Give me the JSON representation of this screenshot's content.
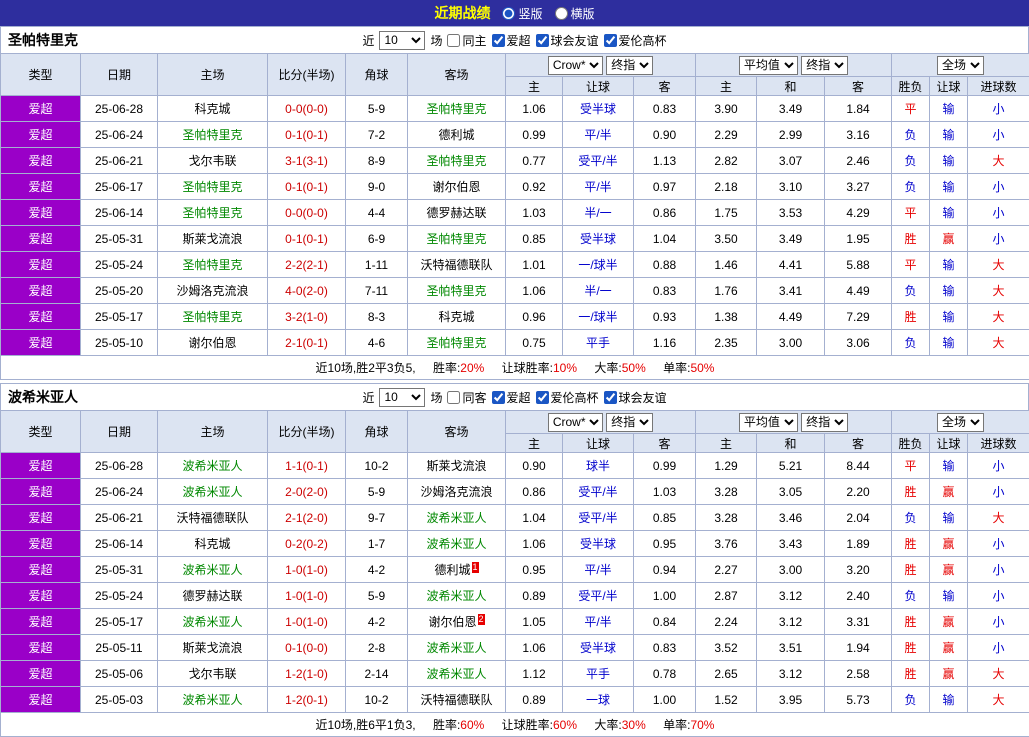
{
  "topbar": {
    "title": "近期战绩",
    "view_options": [
      {
        "label": "竖版",
        "selected": true
      },
      {
        "label": "横版",
        "selected": false
      }
    ]
  },
  "palette": {
    "topbar_bg": "#2e2e9e",
    "title_color": "#ffff00",
    "type_cell_bg": "#9a00c8",
    "header_bg": "#dce4f2",
    "border": "#a4b0d0",
    "win_color": "#e60000",
    "loss_color": "#0000cc",
    "self_team_color": "#008800",
    "score_color": "#cc0000"
  },
  "columns": {
    "type": "类型",
    "date": "日期",
    "home": "主场",
    "score": "比分(半场)",
    "corner": "角球",
    "away": "客场",
    "odds_source": "Crow*",
    "odds_kind": "终指",
    "avg_source": "平均值",
    "avg_kind": "终指",
    "result_scope": "全场",
    "sub_odds_home": "主",
    "sub_odds_handicap": "让球",
    "sub_odds_away": "客",
    "sub_avg_home": "主",
    "sub_avg_draw": "和",
    "sub_avg_away": "客",
    "sub_result": "胜负",
    "sub_handicap_result": "让球",
    "sub_goals": "进球数"
  },
  "sections": [
    {
      "team": "圣帕特里克",
      "filter": {
        "near_label": "近",
        "match_count": "10",
        "games_label": "场",
        "same_venue_label": "同主",
        "same_venue_checked": false,
        "league_options": [
          "爱超",
          "球会友谊",
          "爱伦高杯"
        ]
      },
      "rows": [
        {
          "type": "爱超",
          "date": "25-06-28",
          "home": "科克城",
          "home_color": "black",
          "score": "0-0(0-0)",
          "corner": "5-9",
          "away": "圣帕特里克",
          "away_color": "green",
          "odds_home": "1.06",
          "handicap": "受半球",
          "odds_away": "0.83",
          "avg_home": "3.90",
          "avg_draw": "3.49",
          "avg_away": "1.84",
          "result": "平",
          "result_color": "red",
          "handicap_result": "输",
          "handicap_result_color": "blue",
          "goals": "小",
          "goals_color": "blue"
        },
        {
          "type": "爱超",
          "date": "25-06-24",
          "home": "圣帕特里克",
          "home_color": "green",
          "score": "0-1(0-1)",
          "corner": "7-2",
          "away": "德利城",
          "away_color": "black",
          "odds_home": "0.99",
          "handicap": "平/半",
          "odds_away": "0.90",
          "avg_home": "2.29",
          "avg_draw": "2.99",
          "avg_away": "3.16",
          "result": "负",
          "result_color": "blue",
          "handicap_result": "输",
          "handicap_result_color": "blue",
          "goals": "小",
          "goals_color": "blue"
        },
        {
          "type": "爱超",
          "date": "25-06-21",
          "home": "戈尔韦联",
          "home_color": "black",
          "score": "3-1(3-1)",
          "corner": "8-9",
          "away": "圣帕特里克",
          "away_color": "green",
          "odds_home": "0.77",
          "handicap": "受平/半",
          "odds_away": "1.13",
          "avg_home": "2.82",
          "avg_draw": "3.07",
          "avg_away": "2.46",
          "result": "负",
          "result_color": "blue",
          "handicap_result": "输",
          "handicap_result_color": "blue",
          "goals": "大",
          "goals_color": "red"
        },
        {
          "type": "爱超",
          "date": "25-06-17",
          "home": "圣帕特里克",
          "home_color": "green",
          "score": "0-1(0-1)",
          "corner": "9-0",
          "away": "谢尔伯恩",
          "away_color": "black",
          "odds_home": "0.92",
          "handicap": "平/半",
          "odds_away": "0.97",
          "avg_home": "2.18",
          "avg_draw": "3.10",
          "avg_away": "3.27",
          "result": "负",
          "result_color": "blue",
          "handicap_result": "输",
          "handicap_result_color": "blue",
          "goals": "小",
          "goals_color": "blue"
        },
        {
          "type": "爱超",
          "date": "25-06-14",
          "home": "圣帕特里克",
          "home_color": "green",
          "score": "0-0(0-0)",
          "corner": "4-4",
          "away": "德罗赫达联",
          "away_color": "black",
          "odds_home": "1.03",
          "handicap": "半/一",
          "odds_away": "0.86",
          "avg_home": "1.75",
          "avg_draw": "3.53",
          "avg_away": "4.29",
          "result": "平",
          "result_color": "red",
          "handicap_result": "输",
          "handicap_result_color": "blue",
          "goals": "小",
          "goals_color": "blue"
        },
        {
          "type": "爱超",
          "date": "25-05-31",
          "home": "斯莱戈流浪",
          "home_color": "black",
          "score": "0-1(0-1)",
          "corner": "6-9",
          "away": "圣帕特里克",
          "away_color": "green",
          "odds_home": "0.85",
          "handicap": "受半球",
          "odds_away": "1.04",
          "avg_home": "3.50",
          "avg_draw": "3.49",
          "avg_away": "1.95",
          "result": "胜",
          "result_color": "red",
          "handicap_result": "赢",
          "handicap_result_color": "red",
          "goals": "小",
          "goals_color": "blue"
        },
        {
          "type": "爱超",
          "date": "25-05-24",
          "home": "圣帕特里克",
          "home_color": "green",
          "score": "2-2(2-1)",
          "corner": "1-11",
          "away": "沃特福德联队",
          "away_color": "black",
          "odds_home": "1.01",
          "handicap": "一/球半",
          "odds_away": "0.88",
          "avg_home": "1.46",
          "avg_draw": "4.41",
          "avg_away": "5.88",
          "result": "平",
          "result_color": "red",
          "handicap_result": "输",
          "handicap_result_color": "blue",
          "goals": "大",
          "goals_color": "red"
        },
        {
          "type": "爱超",
          "date": "25-05-20",
          "home": "沙姆洛克流浪",
          "home_color": "black",
          "score": "4-0(2-0)",
          "corner": "7-11",
          "away": "圣帕特里克",
          "away_color": "green",
          "odds_home": "1.06",
          "handicap": "半/一",
          "odds_away": "0.83",
          "avg_home": "1.76",
          "avg_draw": "3.41",
          "avg_away": "4.49",
          "result": "负",
          "result_color": "blue",
          "handicap_result": "输",
          "handicap_result_color": "blue",
          "goals": "大",
          "goals_color": "red"
        },
        {
          "type": "爱超",
          "date": "25-05-17",
          "home": "圣帕特里克",
          "home_color": "green",
          "score": "3-2(1-0)",
          "corner": "8-3",
          "away": "科克城",
          "away_color": "black",
          "odds_home": "0.96",
          "handicap": "一/球半",
          "odds_away": "0.93",
          "avg_home": "1.38",
          "avg_draw": "4.49",
          "avg_away": "7.29",
          "result": "胜",
          "result_color": "red",
          "handicap_result": "输",
          "handicap_result_color": "blue",
          "goals": "大",
          "goals_color": "red"
        },
        {
          "type": "爱超",
          "date": "25-05-10",
          "home": "谢尔伯恩",
          "home_color": "black",
          "score": "2-1(0-1)",
          "corner": "4-6",
          "away": "圣帕特里克",
          "away_color": "green",
          "odds_home": "0.75",
          "handicap": "平手",
          "odds_away": "1.16",
          "avg_home": "2.35",
          "avg_draw": "3.00",
          "avg_away": "3.06",
          "result": "负",
          "result_color": "blue",
          "handicap_result": "输",
          "handicap_result_color": "blue",
          "goals": "大",
          "goals_color": "red"
        }
      ],
      "summary": {
        "prefix": "近10场,胜2平3负5,",
        "stats": [
          {
            "label": "胜率:",
            "value": "20%"
          },
          {
            "label": "让球胜率:",
            "value": "10%"
          },
          {
            "label": "大率:",
            "value": "50%"
          },
          {
            "label": "单率:",
            "value": "50%"
          }
        ]
      }
    },
    {
      "team": "波希米亚人",
      "filter": {
        "near_label": "近",
        "match_count": "10",
        "games_label": "场",
        "same_venue_label": "同客",
        "same_venue_checked": false,
        "league_options": [
          "爱超",
          "爱伦高杯",
          "球会友谊"
        ]
      },
      "rows": [
        {
          "type": "爱超",
          "date": "25-06-28",
          "home": "波希米亚人",
          "home_color": "green",
          "score": "1-1(0-1)",
          "corner": "10-2",
          "away": "斯莱戈流浪",
          "away_color": "black",
          "odds_home": "0.90",
          "handicap": "球半",
          "odds_away": "0.99",
          "avg_home": "1.29",
          "avg_draw": "5.21",
          "avg_away": "8.44",
          "result": "平",
          "result_color": "red",
          "handicap_result": "输",
          "handicap_result_color": "blue",
          "goals": "小",
          "goals_color": "blue"
        },
        {
          "type": "爱超",
          "date": "25-06-24",
          "home": "波希米亚人",
          "home_color": "green",
          "score": "2-0(2-0)",
          "corner": "5-9",
          "away": "沙姆洛克流浪",
          "away_color": "black",
          "odds_home": "0.86",
          "handicap": "受平/半",
          "odds_away": "1.03",
          "avg_home": "3.28",
          "avg_draw": "3.05",
          "avg_away": "2.20",
          "result": "胜",
          "result_color": "red",
          "handicap_result": "赢",
          "handicap_result_color": "red",
          "goals": "小",
          "goals_color": "blue"
        },
        {
          "type": "爱超",
          "date": "25-06-21",
          "home": "沃特福德联队",
          "home_color": "black",
          "score": "2-1(2-0)",
          "corner": "9-7",
          "away": "波希米亚人",
          "away_color": "green",
          "odds_home": "1.04",
          "handicap": "受平/半",
          "odds_away": "0.85",
          "avg_home": "3.28",
          "avg_draw": "3.46",
          "avg_away": "2.04",
          "result": "负",
          "result_color": "blue",
          "handicap_result": "输",
          "handicap_result_color": "blue",
          "goals": "大",
          "goals_color": "red"
        },
        {
          "type": "爱超",
          "date": "25-06-14",
          "home": "科克城",
          "home_color": "black",
          "score": "0-2(0-2)",
          "corner": "1-7",
          "away": "波希米亚人",
          "away_color": "green",
          "odds_home": "1.06",
          "handicap": "受半球",
          "odds_away": "0.95",
          "avg_home": "3.76",
          "avg_draw": "3.43",
          "avg_away": "1.89",
          "result": "胜",
          "result_color": "red",
          "handicap_result": "赢",
          "handicap_result_color": "red",
          "goals": "小",
          "goals_color": "blue"
        },
        {
          "type": "爱超",
          "date": "25-05-31",
          "home": "波希米亚人",
          "home_color": "green",
          "score": "1-0(1-0)",
          "corner": "4-2",
          "away": "德利城",
          "away_color": "black",
          "away_badge": "1",
          "odds_home": "0.95",
          "handicap": "平/半",
          "odds_away": "0.94",
          "avg_home": "2.27",
          "avg_draw": "3.00",
          "avg_away": "3.20",
          "result": "胜",
          "result_color": "red",
          "handicap_result": "赢",
          "handicap_result_color": "red",
          "goals": "小",
          "goals_color": "blue"
        },
        {
          "type": "爱超",
          "date": "25-05-24",
          "home": "德罗赫达联",
          "home_color": "black",
          "score": "1-0(1-0)",
          "corner": "5-9",
          "away": "波希米亚人",
          "away_color": "green",
          "odds_home": "0.89",
          "handicap": "受平/半",
          "odds_away": "1.00",
          "avg_home": "2.87",
          "avg_draw": "3.12",
          "avg_away": "2.40",
          "result": "负",
          "result_color": "blue",
          "handicap_result": "输",
          "handicap_result_color": "blue",
          "goals": "小",
          "goals_color": "blue"
        },
        {
          "type": "爱超",
          "date": "25-05-17",
          "home": "波希米亚人",
          "home_color": "green",
          "score": "1-0(1-0)",
          "corner": "4-2",
          "away": "谢尔伯恩",
          "away_color": "black",
          "away_badge": "2",
          "odds_home": "1.05",
          "handicap": "平/半",
          "odds_away": "0.84",
          "avg_home": "2.24",
          "avg_draw": "3.12",
          "avg_away": "3.31",
          "result": "胜",
          "result_color": "red",
          "handicap_result": "赢",
          "handicap_result_color": "red",
          "goals": "小",
          "goals_color": "blue"
        },
        {
          "type": "爱超",
          "date": "25-05-11",
          "home": "斯莱戈流浪",
          "home_color": "black",
          "score": "0-1(0-0)",
          "corner": "2-8",
          "away": "波希米亚人",
          "away_color": "green",
          "odds_home": "1.06",
          "handicap": "受半球",
          "odds_away": "0.83",
          "avg_home": "3.52",
          "avg_draw": "3.51",
          "avg_away": "1.94",
          "result": "胜",
          "result_color": "red",
          "handicap_result": "赢",
          "handicap_result_color": "red",
          "goals": "小",
          "goals_color": "blue"
        },
        {
          "type": "爱超",
          "date": "25-05-06",
          "home": "戈尔韦联",
          "home_color": "black",
          "score": "1-2(1-0)",
          "corner": "2-14",
          "away": "波希米亚人",
          "away_color": "green",
          "odds_home": "1.12",
          "handicap": "平手",
          "odds_away": "0.78",
          "avg_home": "2.65",
          "avg_draw": "3.12",
          "avg_away": "2.58",
          "result": "胜",
          "result_color": "red",
          "handicap_result": "赢",
          "handicap_result_color": "red",
          "goals": "大",
          "goals_color": "red"
        },
        {
          "type": "爱超",
          "date": "25-05-03",
          "home": "波希米亚人",
          "home_color": "green",
          "score": "1-2(0-1)",
          "corner": "10-2",
          "away": "沃特福德联队",
          "away_color": "black",
          "odds_home": "0.89",
          "handicap": "一球",
          "odds_away": "1.00",
          "avg_home": "1.52",
          "avg_draw": "3.95",
          "avg_away": "5.73",
          "result": "负",
          "result_color": "blue",
          "handicap_result": "输",
          "handicap_result_color": "blue",
          "goals": "大",
          "goals_color": "red"
        }
      ],
      "summary": {
        "prefix": "近10场,胜6平1负3,",
        "stats": [
          {
            "label": "胜率:",
            "value": "60%"
          },
          {
            "label": "让球胜率:",
            "value": "60%"
          },
          {
            "label": "大率:",
            "value": "30%"
          },
          {
            "label": "单率:",
            "value": "70%"
          }
        ]
      }
    }
  ]
}
